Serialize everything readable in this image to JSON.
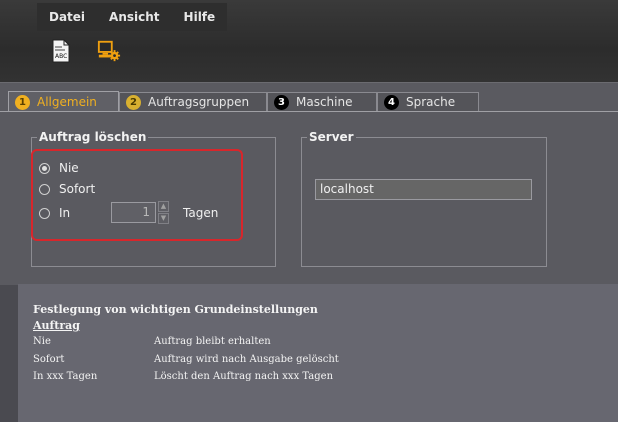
{
  "menu": {
    "items": [
      "Datei",
      "Ansicht",
      "Hilfe"
    ]
  },
  "toolbar": {
    "tools": [
      {
        "icon": "abc-document-icon"
      },
      {
        "icon": "computer-settings-icon"
      }
    ]
  },
  "tabs": [
    {
      "number": "1",
      "label": "Allgemein",
      "active": true
    },
    {
      "number": "2",
      "label": "Auftragsgruppen",
      "active": false
    },
    {
      "number": "3",
      "label": "Maschine",
      "active": false
    },
    {
      "number": "4",
      "label": "Sprache",
      "active": false
    }
  ],
  "auftrag": {
    "title": "Auftrag löschen",
    "options": [
      "Nie",
      "Sofort",
      "In"
    ],
    "selected": "Nie",
    "days_value": "1",
    "days_unit": "Tagen"
  },
  "server": {
    "title": "Server",
    "value": "localhost"
  },
  "help": {
    "title": "Festlegung von wichtigen Grundeinstellungen",
    "subtitle": "Auftrag",
    "rows": [
      {
        "term": "Nie",
        "desc": "Auftrag bleibt erhalten"
      },
      {
        "term": "Sofort",
        "desc": "Auftrag wird nach Ausgabe gelöscht"
      },
      {
        "term": "In xxx Tagen",
        "desc": "Löscht den Auftrag nach xxx Tagen"
      }
    ]
  },
  "colors": {
    "accent": "#f0b020",
    "highlight": "#d8262b"
  }
}
